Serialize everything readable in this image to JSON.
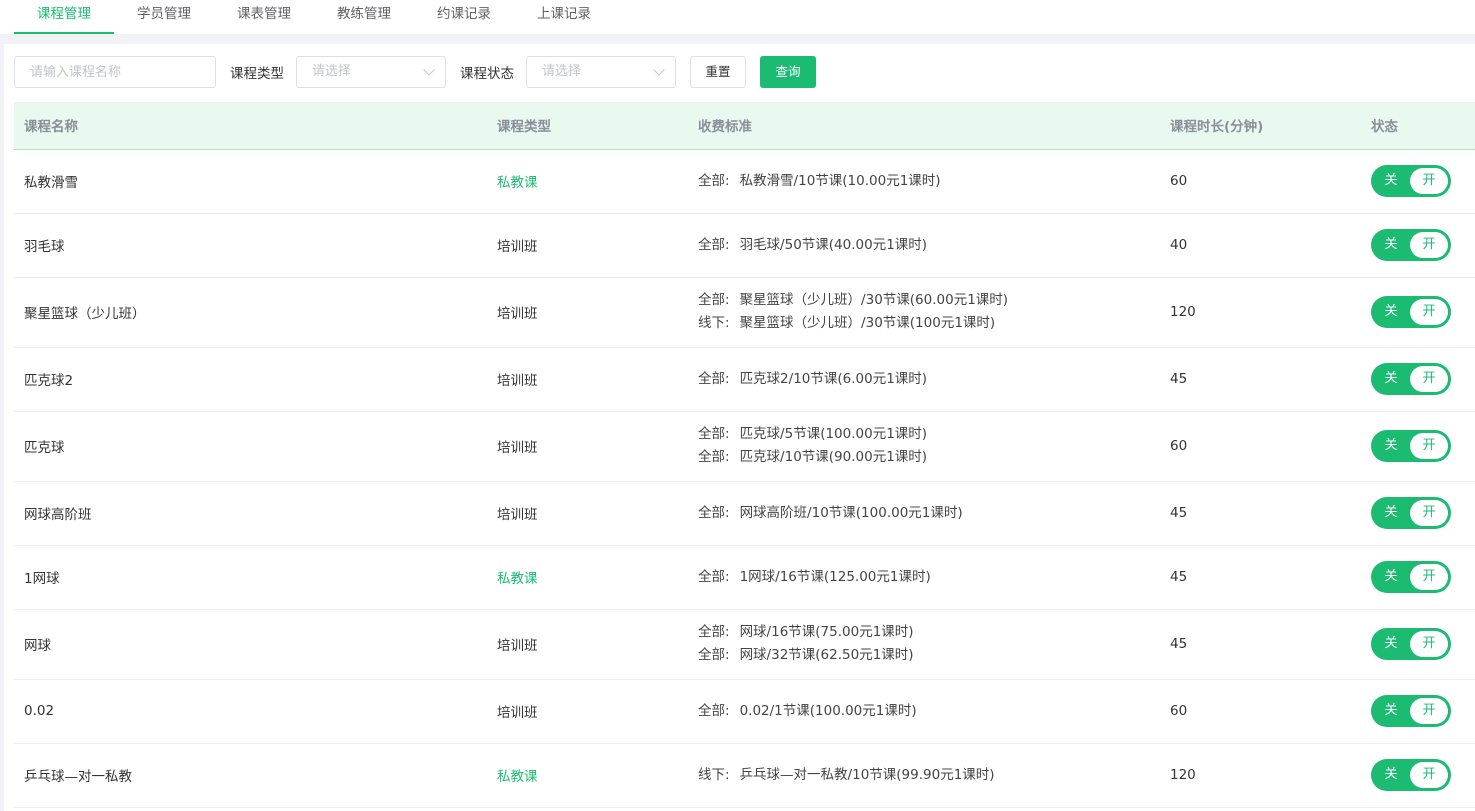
{
  "tabs": [
    "课程管理",
    "学员管理",
    "课表管理",
    "教练管理",
    "约课记录",
    "上课记录"
  ],
  "filters": {
    "name_placeholder": "请输入课程名称",
    "type_label": "课程类型",
    "type_placeholder": "请选择",
    "status_label": "课程状态",
    "status_placeholder": "请选择",
    "reset_label": "重置",
    "query_label": "查询"
  },
  "table": {
    "headers": [
      "课程名称",
      "课程类型",
      "收费标准",
      "课程时长(分钟)",
      "状态"
    ],
    "rows": [
      {
        "name": "私教滑雪",
        "type": "私教课",
        "fees": [
          {
            "label": "全部:",
            "text": "私教滑雪/10节课(10.00元1课时)"
          }
        ],
        "duration": "60",
        "status_off": "关",
        "status_on": "开"
      },
      {
        "name": "羽毛球",
        "type": "培训班",
        "fees": [
          {
            "label": "全部:",
            "text": "羽毛球/50节课(40.00元1课时)"
          }
        ],
        "duration": "40",
        "status_off": "关",
        "status_on": "开"
      },
      {
        "name": "聚星篮球（少儿班）",
        "type": "培训班",
        "fees": [
          {
            "label": "全部:",
            "text": "聚星篮球（少儿班）/30节课(60.00元1课时)"
          },
          {
            "label": "线下:",
            "text": "聚星篮球（少儿班）/30节课(100元1课时)"
          }
        ],
        "duration": "120",
        "status_off": "关",
        "status_on": "开"
      },
      {
        "name": "匹克球2",
        "type": "培训班",
        "fees": [
          {
            "label": "全部:",
            "text": "匹克球2/10节课(6.00元1课时)"
          }
        ],
        "duration": "45",
        "status_off": "关",
        "status_on": "开"
      },
      {
        "name": "匹克球",
        "type": "培训班",
        "fees": [
          {
            "label": "全部:",
            "text": "匹克球/5节课(100.00元1课时)"
          },
          {
            "label": "全部:",
            "text": "匹克球/10节课(90.00元1课时)"
          }
        ],
        "duration": "60",
        "status_off": "关",
        "status_on": "开"
      },
      {
        "name": "网球高阶班",
        "type": "培训班",
        "fees": [
          {
            "label": "全部:",
            "text": "网球高阶班/10节课(100.00元1课时)"
          }
        ],
        "duration": "45",
        "status_off": "关",
        "status_on": "开"
      },
      {
        "name": "1网球",
        "type": "私教课",
        "fees": [
          {
            "label": "全部:",
            "text": "1网球/16节课(125.00元1课时)"
          }
        ],
        "duration": "45",
        "status_off": "关",
        "status_on": "开"
      },
      {
        "name": "网球",
        "type": "培训班",
        "fees": [
          {
            "label": "全部:",
            "text": "网球/16节课(75.00元1课时)"
          },
          {
            "label": "全部:",
            "text": "网球/32节课(62.50元1课时)"
          }
        ],
        "duration": "45",
        "status_off": "关",
        "status_on": "开"
      },
      {
        "name": "0.02",
        "type": "培训班",
        "fees": [
          {
            "label": "全部:",
            "text": "0.02/1节课(100.00元1课时)"
          }
        ],
        "duration": "60",
        "status_off": "关",
        "status_on": "开"
      },
      {
        "name": "乒乓球—对一私教",
        "type": "私教课",
        "fees": [
          {
            "label": "线下:",
            "text": "乒乓球—对一私教/10节课(99.90元1课时)"
          }
        ],
        "duration": "120",
        "status_off": "关",
        "status_on": "开"
      }
    ]
  },
  "colors": {
    "accent": "#1bbc72",
    "header_bg": "#e9f9ef"
  }
}
